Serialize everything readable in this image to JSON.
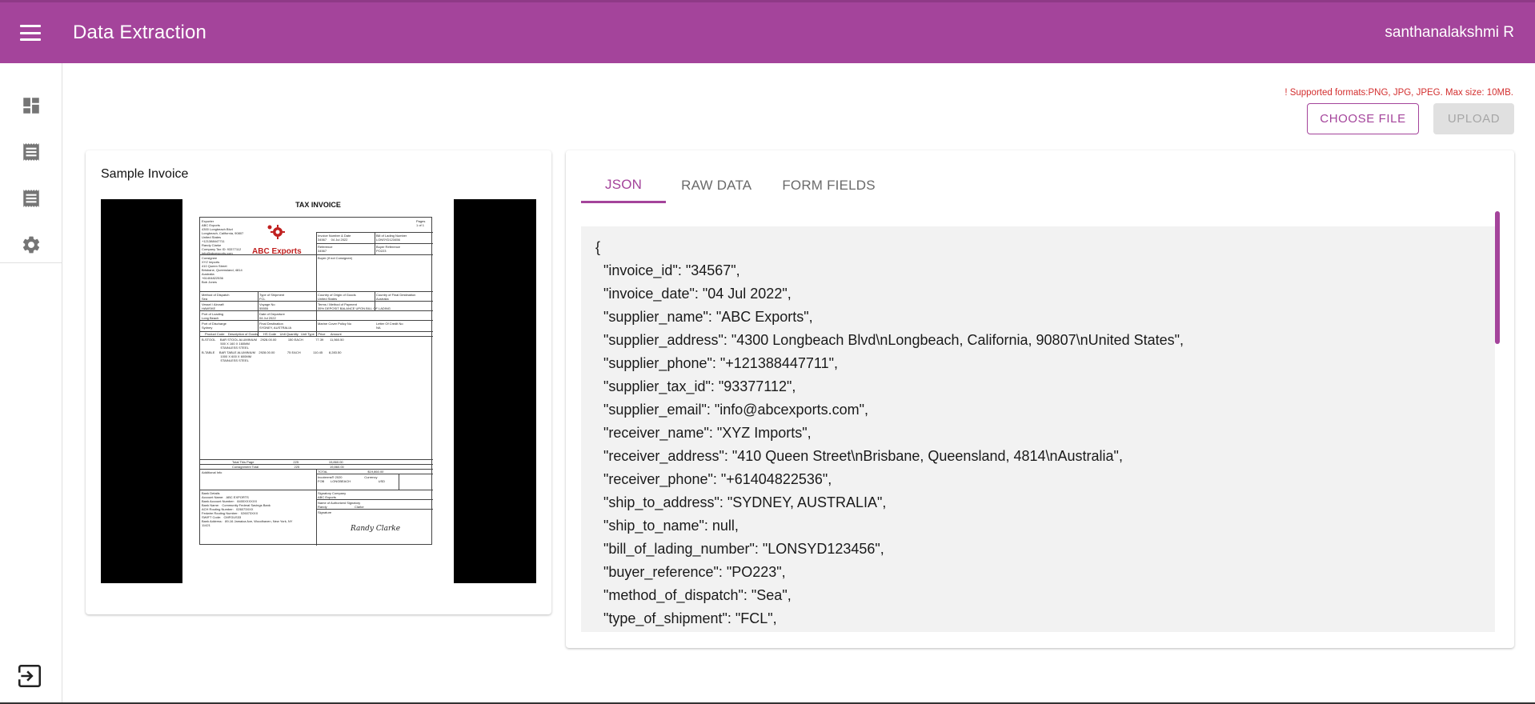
{
  "header": {
    "title": "Data Extraction",
    "user": "santhanalakshmi R",
    "bg_color": "#a4449b"
  },
  "sidebar": {
    "items": [
      {
        "icon": "dashboard-icon"
      },
      {
        "icon": "receipt-icon"
      },
      {
        "icon": "receipt-icon"
      },
      {
        "icon": "gear-icon"
      }
    ],
    "logout_icon": "logout-icon"
  },
  "upload": {
    "hint": "! Supported formats:PNG, JPG, JPEG. Max size: 10MB.",
    "choose_label": "CHOOSE FILE",
    "upload_label": "UPLOAD"
  },
  "preview": {
    "title": "Sample Invoice",
    "invoice_heading": "TAX INVOICE",
    "company_logo": "ABC Exports",
    "signature": "Randy Clarke"
  },
  "tabs": [
    {
      "label": "JSON",
      "active": true
    },
    {
      "label": "RAW DATA",
      "active": false
    },
    {
      "label": "FORM FIELDS",
      "active": false
    }
  ],
  "json_view": {
    "lines": [
      "{",
      "  \"invoice_id\": \"34567\",",
      "  \"invoice_date\": \"04 Jul 2022\",",
      "  \"supplier_name\": \"ABC Exports\",",
      "  \"supplier_address\": \"4300 Longbeach Blvd\\nLongbeach, California, 90807\\nUnited States\",",
      "  \"supplier_phone\": \"+121388447711\",",
      "  \"supplier_tax_id\": \"93377112\",",
      "  \"supplier_email\": \"info@abcexports.com\",",
      "  \"receiver_name\": \"XYZ Imports\",",
      "  \"receiver_address\": \"410 Queen Street\\nBrisbane, Queensland, 4814\\nAustralia\",",
      "  \"receiver_phone\": \"+61404822536\",",
      "  \"ship_to_address\": \"SYDNEY, AUSTRALIA\",",
      "  \"ship_to_name\": null,",
      "  \"bill_of_lading_number\": \"LONSYD123456\",",
      "  \"buyer_reference\": \"PO223\",",
      "  \"method_of_dispatch\": \"Sea\",",
      "  \"type_of_shipment\": \"FCL\","
    ]
  }
}
